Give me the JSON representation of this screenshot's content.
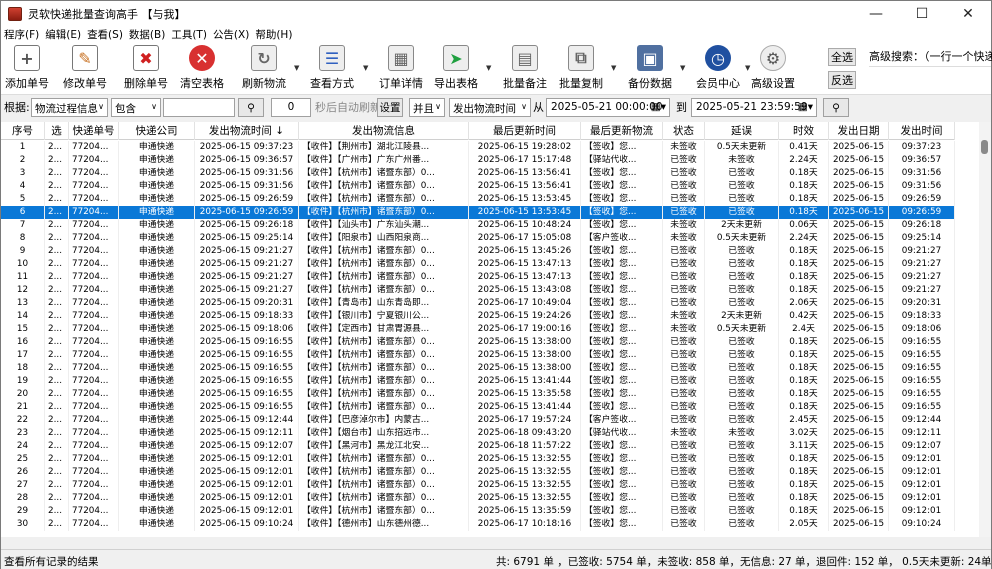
{
  "window": {
    "title": "灵软快递批量查询高手 【与我】"
  },
  "menu": [
    "程序(F)",
    "编辑(E)",
    "查看(S)",
    "数据(B)",
    "工具(T)",
    "公告(X)",
    "帮助(H)"
  ],
  "toolbar": {
    "add": "添加单号",
    "edit": "修改单号",
    "delete": "删除单号",
    "clear": "清空表格",
    "refresh": "刷新物流",
    "view": "查看方式",
    "detail": "订单详情",
    "export": "导出表格",
    "batch_note": "批量备注",
    "batch_copy": "批量复制",
    "backup": "备份数据",
    "member": "会员中心",
    "settings": "高级设置",
    "select_all": "全选",
    "invert": "反选",
    "adv_search_label": "高级搜索：（一行一个快递单"
  },
  "filter": {
    "basis_label": "根据:",
    "basis_value": "物流过程信息",
    "contain_value": "包含",
    "search_value": "",
    "auto_refresh_value": "0",
    "auto_refresh_label": "秒后自动刷新",
    "settings_btn": "设置",
    "and_value": "并且",
    "time_field_value": "发出物流时间",
    "from_label": "从",
    "from_value": "2025-05-21 00:00:00",
    "to_label": "到",
    "to_value": "2025-05-21 23:59:59"
  },
  "table": {
    "headers": [
      "序号",
      "选",
      "快递单号",
      "快递公司",
      "发出物流时间 ↓",
      "发出物流信息",
      "最后更新时间",
      "最后更新物流",
      "状态",
      "延误",
      "时效",
      "发出日期",
      "发出时间"
    ],
    "selected_index": 5,
    "rows": [
      [
        "1",
        "2...",
        "77204...",
        "申通快递",
        "2025-06-15 09:37:23",
        "【收件】【荆州市】湖北江陵县...",
        "2025-06-15 19:28:02",
        "【签收】您...",
        "未签收",
        "0.5天未更新",
        "0.41天",
        "2025-06-15",
        "09:37:23"
      ],
      [
        "2",
        "2...",
        "77204...",
        "申通快递",
        "2025-06-15 09:36:57",
        "【收件】【广州市】广东广州番...",
        "2025-06-17 15:17:48",
        "【驿站代收...",
        "已签收",
        "未签收",
        "2.24天",
        "2025-06-15",
        "09:36:57"
      ],
      [
        "3",
        "2...",
        "77204...",
        "申通快递",
        "2025-06-15 09:31:56",
        "【收件】【杭州市】诸暨东部）0...",
        "2025-06-15 13:56:41",
        "【签收】您...",
        "已签收",
        "已签收",
        "0.18天",
        "2025-06-15",
        "09:31:56"
      ],
      [
        "4",
        "2...",
        "77204...",
        "申通快递",
        "2025-06-15 09:31:56",
        "【收件】【杭州市】诸暨东部）0...",
        "2025-06-15 13:56:41",
        "【签收】您...",
        "已签收",
        "已签收",
        "0.18天",
        "2025-06-15",
        "09:31:56"
      ],
      [
        "5",
        "2...",
        "77204...",
        "申通快递",
        "2025-06-15 09:26:59",
        "【收件】【杭州市】诸暨东部）0...",
        "2025-06-15 13:53:45",
        "【签收】您...",
        "已签收",
        "已签收",
        "0.18天",
        "2025-06-15",
        "09:26:59"
      ],
      [
        "6",
        "2...",
        "77204...",
        "申通快递",
        "2025-06-15 09:26:59",
        "【收件】【杭州市】诸暨东部）0...",
        "2025-06-15 13:53:45",
        "【签收】您...",
        "已签收",
        "已签收",
        "0.18天",
        "2025-06-15",
        "09:26:59"
      ],
      [
        "7",
        "2...",
        "77204...",
        "申通快递",
        "2025-06-15 09:26:18",
        "【收件】【汕头市】广东汕头潮...",
        "2025-06-15 10:48:24",
        "【签收】您...",
        "未签收",
        "2天未更新",
        "0.06天",
        "2025-06-15",
        "09:26:18"
      ],
      [
        "8",
        "2...",
        "77204...",
        "申通快递",
        "2025-06-15 09:25:14",
        "【收件】【阳泉市】山西阳泉商...",
        "2025-06-17 15:05:08",
        "【客户签收...",
        "未签收",
        "0.5天未更新",
        "2.24天",
        "2025-06-15",
        "09:25:14"
      ],
      [
        "9",
        "2...",
        "77204...",
        "申通快递",
        "2025-06-15 09:21:27",
        "【收件】【杭州市】诸暨东部）0...",
        "2025-06-15 13:45:26",
        "【签收】您...",
        "已签收",
        "已签收",
        "0.18天",
        "2025-06-15",
        "09:21:27"
      ],
      [
        "10",
        "2...",
        "77204...",
        "申通快递",
        "2025-06-15 09:21:27",
        "【收件】【杭州市】诸暨东部）0...",
        "2025-06-15 13:47:13",
        "【签收】您...",
        "已签收",
        "已签收",
        "0.18天",
        "2025-06-15",
        "09:21:27"
      ],
      [
        "11",
        "2...",
        "77204...",
        "申通快递",
        "2025-06-15 09:21:27",
        "【收件】【杭州市】诸暨东部）0...",
        "2025-06-15 13:47:13",
        "【签收】您...",
        "已签收",
        "已签收",
        "0.18天",
        "2025-06-15",
        "09:21:27"
      ],
      [
        "12",
        "2...",
        "77204...",
        "申通快递",
        "2025-06-15 09:21:27",
        "【收件】【杭州市】诸暨东部）0...",
        "2025-06-15 13:43:08",
        "【签收】您...",
        "已签收",
        "已签收",
        "0.18天",
        "2025-06-15",
        "09:21:27"
      ],
      [
        "13",
        "2...",
        "77204...",
        "申通快递",
        "2025-06-15 09:20:31",
        "【收件】【青岛市】山东青岛即...",
        "2025-06-17 10:49:04",
        "【签收】您...",
        "已签收",
        "已签收",
        "2.06天",
        "2025-06-15",
        "09:20:31"
      ],
      [
        "14",
        "2...",
        "77204...",
        "申通快递",
        "2025-06-15 09:18:33",
        "【收件】【银川市】宁夏银川公...",
        "2025-06-15 19:24:26",
        "【签收】您...",
        "未签收",
        "2天未更新",
        "0.42天",
        "2025-06-15",
        "09:18:33"
      ],
      [
        "15",
        "2...",
        "77204...",
        "申通快递",
        "2025-06-15 09:18:06",
        "【收件】【定西市】甘肃胃源县...",
        "2025-06-17 19:00:16",
        "【签收】您...",
        "未签收",
        "0.5天未更新",
        "2.4天",
        "2025-06-15",
        "09:18:06"
      ],
      [
        "16",
        "2...",
        "77204...",
        "申通快递",
        "2025-06-15 09:16:55",
        "【收件】【杭州市】诸暨东部）0...",
        "2025-06-15 13:38:00",
        "【签收】您...",
        "已签收",
        "已签收",
        "0.18天",
        "2025-06-15",
        "09:16:55"
      ],
      [
        "17",
        "2...",
        "77204...",
        "申通快递",
        "2025-06-15 09:16:55",
        "【收件】【杭州市】诸暨东部）0...",
        "2025-06-15 13:38:00",
        "【签收】您...",
        "已签收",
        "已签收",
        "0.18天",
        "2025-06-15",
        "09:16:55"
      ],
      [
        "18",
        "2...",
        "77204...",
        "申通快递",
        "2025-06-15 09:16:55",
        "【收件】【杭州市】诸暨东部）0...",
        "2025-06-15 13:38:00",
        "【签收】您...",
        "已签收",
        "已签收",
        "0.18天",
        "2025-06-15",
        "09:16:55"
      ],
      [
        "19",
        "2...",
        "77204...",
        "申通快递",
        "2025-06-15 09:16:55",
        "【收件】【杭州市】诸暨东部）0...",
        "2025-06-15 13:41:44",
        "【签收】您...",
        "已签收",
        "已签收",
        "0.18天",
        "2025-06-15",
        "09:16:55"
      ],
      [
        "20",
        "2...",
        "77204...",
        "申通快递",
        "2025-06-15 09:16:55",
        "【收件】【杭州市】诸暨东部）0...",
        "2025-06-15 13:35:58",
        "【签收】您...",
        "已签收",
        "已签收",
        "0.18天",
        "2025-06-15",
        "09:16:55"
      ],
      [
        "21",
        "2...",
        "77204...",
        "申通快递",
        "2025-06-15 09:16:55",
        "【收件】【杭州市】诸暨东部）0...",
        "2025-06-15 13:41:44",
        "【签收】您...",
        "已签收",
        "已签收",
        "0.18天",
        "2025-06-15",
        "09:16:55"
      ],
      [
        "22",
        "2...",
        "77204...",
        "申通快递",
        "2025-06-15 09:12:44",
        "【收件】【巴彦淖尔市】内蒙古...",
        "2025-06-17 19:57:24",
        "【客户签收...",
        "已签收",
        "已签收",
        "2.45天",
        "2025-06-15",
        "09:12:44"
      ],
      [
        "23",
        "2...",
        "77204...",
        "申通快递",
        "2025-06-15 09:12:11",
        "【收件】【烟台市】山东招远市...",
        "2025-06-18 09:43:20",
        "【驿站代收...",
        "未签收",
        "未签收",
        "3.02天",
        "2025-06-15",
        "09:12:11"
      ],
      [
        "24",
        "2...",
        "77204...",
        "申通快递",
        "2025-06-15 09:12:07",
        "【收件】【黑河市】黑龙江北安...",
        "2025-06-18 11:57:22",
        "【签收】您...",
        "已签收",
        "已签收",
        "3.11天",
        "2025-06-15",
        "09:12:07"
      ],
      [
        "25",
        "2...",
        "77204...",
        "申通快递",
        "2025-06-15 09:12:01",
        "【收件】【杭州市】诸暨东部）0...",
        "2025-06-15 13:32:55",
        "【签收】您...",
        "已签收",
        "已签收",
        "0.18天",
        "2025-06-15",
        "09:12:01"
      ],
      [
        "26",
        "2...",
        "77204...",
        "申通快递",
        "2025-06-15 09:12:01",
        "【收件】【杭州市】诸暨东部）0...",
        "2025-06-15 13:32:55",
        "【签收】您...",
        "已签收",
        "已签收",
        "0.18天",
        "2025-06-15",
        "09:12:01"
      ],
      [
        "27",
        "2...",
        "77204...",
        "申通快递",
        "2025-06-15 09:12:01",
        "【收件】【杭州市】诸暨东部）0...",
        "2025-06-15 13:32:55",
        "【签收】您...",
        "已签收",
        "已签收",
        "0.18天",
        "2025-06-15",
        "09:12:01"
      ],
      [
        "28",
        "2...",
        "77204...",
        "申通快递",
        "2025-06-15 09:12:01",
        "【收件】【杭州市】诸暨东部）0...",
        "2025-06-15 13:32:55",
        "【签收】您...",
        "已签收",
        "已签收",
        "0.18天",
        "2025-06-15",
        "09:12:01"
      ],
      [
        "29",
        "2...",
        "77204...",
        "申通快递",
        "2025-06-15 09:12:01",
        "【收件】【杭州市】诸暨东部）0...",
        "2025-06-15 13:35:59",
        "【签收】您...",
        "已签收",
        "已签收",
        "0.18天",
        "2025-06-15",
        "09:12:01"
      ],
      [
        "30",
        "2...",
        "77204...",
        "申通快递",
        "2025-06-15 09:10:24",
        "【收件】【德州市】山东德州德...",
        "2025-06-17 10:18:16",
        "【签收】您...",
        "已签收",
        "已签收",
        "2.05天",
        "2025-06-15",
        "09:10:24"
      ]
    ]
  },
  "status": {
    "left": "查看所有记录的结果",
    "right": "共: 6791 单 ，已签收: 5754 单，未签收: 858 单，无信息: 27 单，退回件: 152 单， 0.5天未更新: 24单"
  }
}
